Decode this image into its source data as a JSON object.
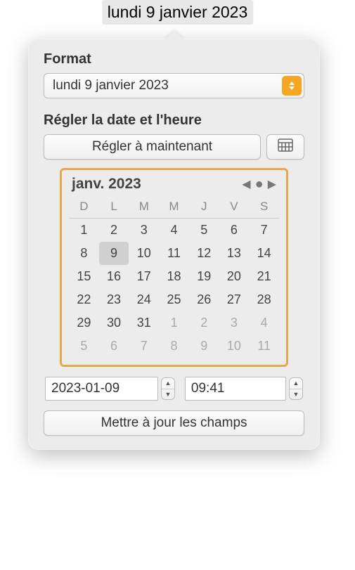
{
  "title": "lundi 9 janvier 2023",
  "format": {
    "label": "Format",
    "selected": "lundi 9 janvier 2023"
  },
  "datetime": {
    "label": "Régler la date et l'heure",
    "set_now": "Régler à maintenant"
  },
  "calendar": {
    "month_label": "janv. 2023",
    "dow": [
      "D",
      "L",
      "M",
      "M",
      "J",
      "V",
      "S"
    ],
    "weeks": [
      [
        {
          "d": 1
        },
        {
          "d": 2
        },
        {
          "d": 3
        },
        {
          "d": 4
        },
        {
          "d": 5
        },
        {
          "d": 6
        },
        {
          "d": 7
        }
      ],
      [
        {
          "d": 8
        },
        {
          "d": 9,
          "sel": true
        },
        {
          "d": 10
        },
        {
          "d": 11
        },
        {
          "d": 12
        },
        {
          "d": 13
        },
        {
          "d": 14
        }
      ],
      [
        {
          "d": 15
        },
        {
          "d": 16
        },
        {
          "d": 17
        },
        {
          "d": 18
        },
        {
          "d": 19
        },
        {
          "d": 20
        },
        {
          "d": 21
        }
      ],
      [
        {
          "d": 22
        },
        {
          "d": 23
        },
        {
          "d": 24
        },
        {
          "d": 25
        },
        {
          "d": 26
        },
        {
          "d": 27
        },
        {
          "d": 28
        }
      ],
      [
        {
          "d": 29
        },
        {
          "d": 30
        },
        {
          "d": 31
        },
        {
          "d": 1,
          "dim": true
        },
        {
          "d": 2,
          "dim": true
        },
        {
          "d": 3,
          "dim": true
        },
        {
          "d": 4,
          "dim": true
        }
      ],
      [
        {
          "d": 5,
          "dim": true
        },
        {
          "d": 6,
          "dim": true
        },
        {
          "d": 7,
          "dim": true
        },
        {
          "d": 8,
          "dim": true
        },
        {
          "d": 9,
          "dim": true
        },
        {
          "d": 10,
          "dim": true
        },
        {
          "d": 11,
          "dim": true
        }
      ]
    ]
  },
  "date_field": "2023-01-09",
  "time_field": "09:41",
  "update_button": "Mettre à jour les champs"
}
